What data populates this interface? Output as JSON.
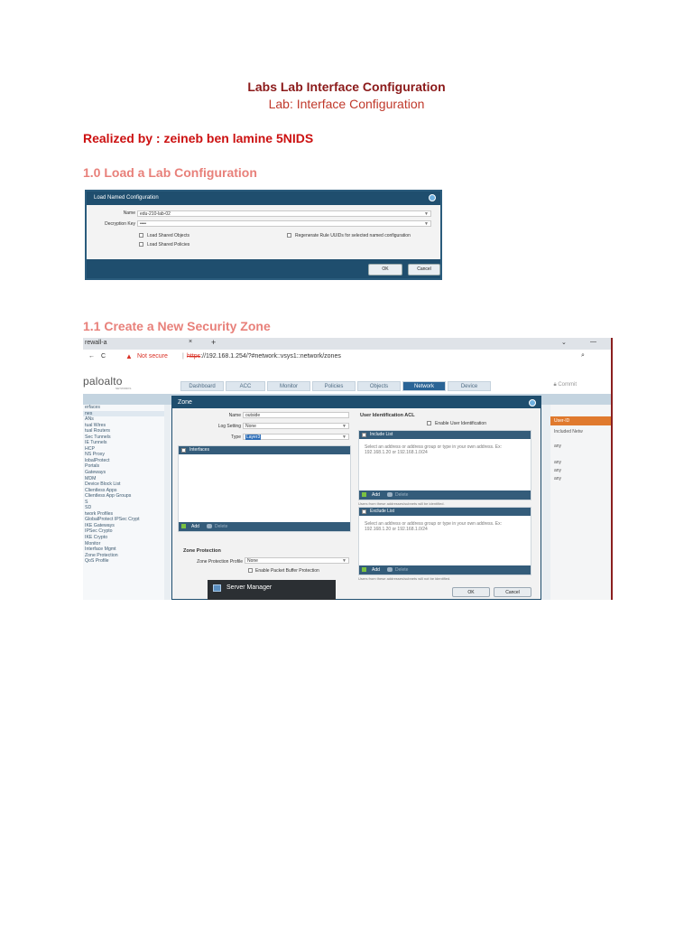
{
  "doc": {
    "title": "Labs Lab Interface Configuration",
    "subtitle": "Lab: Interface Configuration",
    "realized": "Realized by : zeineb ben lamine 5NIDS",
    "section1": "1.0 Load a Lab Configuration",
    "section2": "1.1 Create a New Security Zone"
  },
  "load_dialog": {
    "title": "Load Named Configuration",
    "name_label": "Name",
    "name_value": "edu-210-lab-02",
    "decryption_label": "Decryption Key",
    "decryption_value": "••••",
    "load_shared_objects": "Load Shared Objects",
    "load_shared_policies": "Load Shared Policies",
    "regenerate": "Regenerate Rule UUIDs for selected named configuration",
    "ok": "OK",
    "cancel": "Cancel"
  },
  "browser": {
    "tab_title": "rewall-a",
    "tab_close": "×",
    "new_tab": "+",
    "back": "←",
    "reload": "C",
    "not_secure": "Not secure",
    "url_https": "https",
    "url_rest": "://192.168.1.254/?#network::vsys1::network/zones",
    "logo": "paloalto",
    "logo_sub": "NETWORKS",
    "nav": [
      "Dashboard",
      "ACC",
      "Monitor",
      "Policies",
      "Objects",
      "Network",
      "Device"
    ],
    "active_nav": "Network",
    "commit": "Commit"
  },
  "sidebar": {
    "items": [
      "erfaces",
      "nes",
      "ANs",
      "tual Wires",
      "tual Routers",
      "Sec Tunnels",
      "IE Tunnels",
      "HCP",
      "NS Proxy",
      "lobalProtect",
      "Portals",
      "Gateways",
      "MDM",
      "Device Block List",
      "Clientless Apps",
      "Clientless App Groups",
      "S",
      "SD",
      "twork Profiles",
      "GlobalProtect IPSec Crypt",
      "IKE Gateways",
      "IPSec Crypto",
      "IKE Crypto",
      "Monitor",
      "Interface Mgmt",
      "Zone Protection",
      "QoS Profile"
    ]
  },
  "right_column": {
    "header": "User-ID",
    "rows": [
      "Included Netw",
      "any",
      "any",
      "any",
      "any"
    ]
  },
  "zone_dialog": {
    "title": "Zone",
    "name_label": "Name",
    "name_value": "outside",
    "log_label": "Log Setting",
    "log_value": "None",
    "type_label": "Type",
    "type_value": "Layer3",
    "interfaces_header": "Interfaces",
    "add": "Add",
    "delete": "Delete",
    "zone_protection_header": "Zone Protection",
    "zone_protection_label": "Zone Protection Profile",
    "zone_protection_value": "None",
    "packet_buffer": "Enable Packet Buffer Protection",
    "uid_header": "User Identification ACL",
    "enable_uid": "Enable User Identification",
    "include_header": "Include List",
    "include_hint": "Select an address or address group or type in your own address. Ex: 192.168.1.20 or 192.168.1.0/24",
    "include_footer_note": "Users from these addresses/subnets will be identified.",
    "exclude_header": "Exclude List",
    "exclude_hint": "Select an address or address group or type in your own address. Ex: 192.168.1.20 or 192.168.1.0/24",
    "exclude_footer_note": "Users from these addresses/subnets will not be identified.",
    "ok": "OK",
    "cancel": "Cancel"
  },
  "taskbar": {
    "label": "Server Manager"
  }
}
